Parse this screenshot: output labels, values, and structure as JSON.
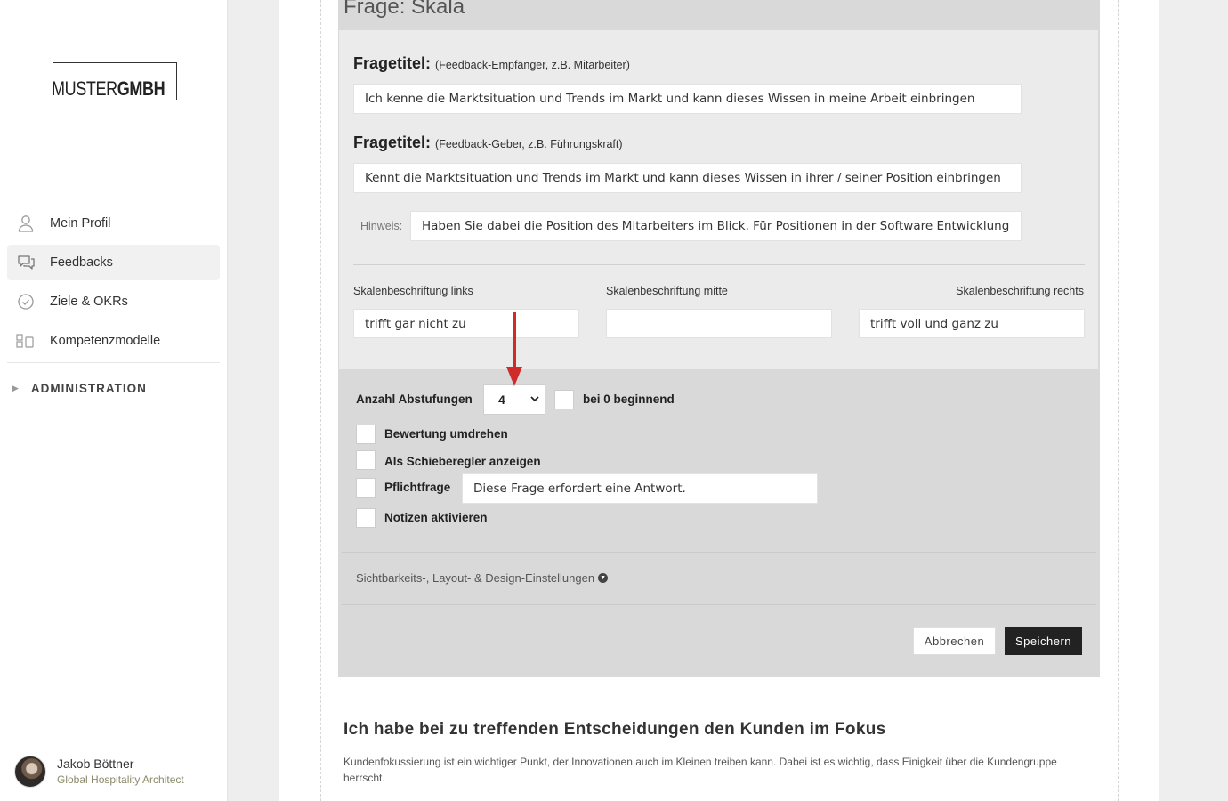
{
  "brand": {
    "logo_light": "MUSTER",
    "logo_bold": "GMBH"
  },
  "sidebar": {
    "items": [
      {
        "label": "Mein Profil",
        "icon": "user-icon",
        "active": false
      },
      {
        "label": "Feedbacks",
        "icon": "chat-bubbles-icon",
        "active": true
      },
      {
        "label": "Ziele & OKRs",
        "icon": "check-circle-icon",
        "active": false
      },
      {
        "label": "Kompetenzmodelle",
        "icon": "blocks-icon",
        "active": false
      }
    ],
    "admin_label": "ADMINISTRATION"
  },
  "user": {
    "name": "Jakob Böttner",
    "role": "Global Hospitality Architect"
  },
  "editor": {
    "panel_title": "Frage: Skala",
    "title_label": "Fragetitel:",
    "recipient_note": "(Feedback-Empfänger, z.B. Mitarbeiter)",
    "recipient_value": "Ich kenne die Marktsituation und Trends im Markt und kann dieses Wissen in meine Arbeit einbringen",
    "giver_note": "(Feedback-Geber, z.B. Führungskraft)",
    "giver_value": "Kennt die Marktsituation und Trends im Markt und kann dieses Wissen in ihrer / seiner Position einbringen",
    "hint_label": "Hinweis:",
    "hint_value": "Haben Sie dabei die Position des Mitarbeiters im Blick. Für Positionen in der Software Entwicklung",
    "scale_left_label": "Skalenbeschriftung links",
    "scale_mid_label": "Skalenbeschriftung mitte",
    "scale_right_label": "Skalenbeschriftung rechts",
    "scale_left_value": "trifft gar nicht zu",
    "scale_mid_value": "",
    "scale_right_value": "trifft voll und ganz zu",
    "steps_label": "Anzahl Abstufungen",
    "steps_value": "4",
    "start_zero_label": "bei 0 beginnend",
    "reverse_label": "Bewertung umdrehen",
    "slider_label": "Als Schieberegler anzeigen",
    "required_label": "Pflichtfrage",
    "required_message": "Diese Frage erfordert eine Antwort.",
    "notes_label": "Notizen aktivieren",
    "design_link": "Sichtbarkeits-, Layout- & Design-Einstellungen",
    "cancel": "Abbrechen",
    "save": "Speichern"
  },
  "next_question": {
    "title": "Ich habe bei zu treffenden Entscheidungen den Kunden im Fokus",
    "description": "Kundenfokussierung ist ein wichtiger Punkt, der Innovationen auch im Kleinen treiben kann. Dabei ist es wichtig, dass Einigkeit über die Kundengruppe herrscht."
  },
  "colors": {
    "accent_arrow": "#d02a2a",
    "save_button": "#222222"
  }
}
